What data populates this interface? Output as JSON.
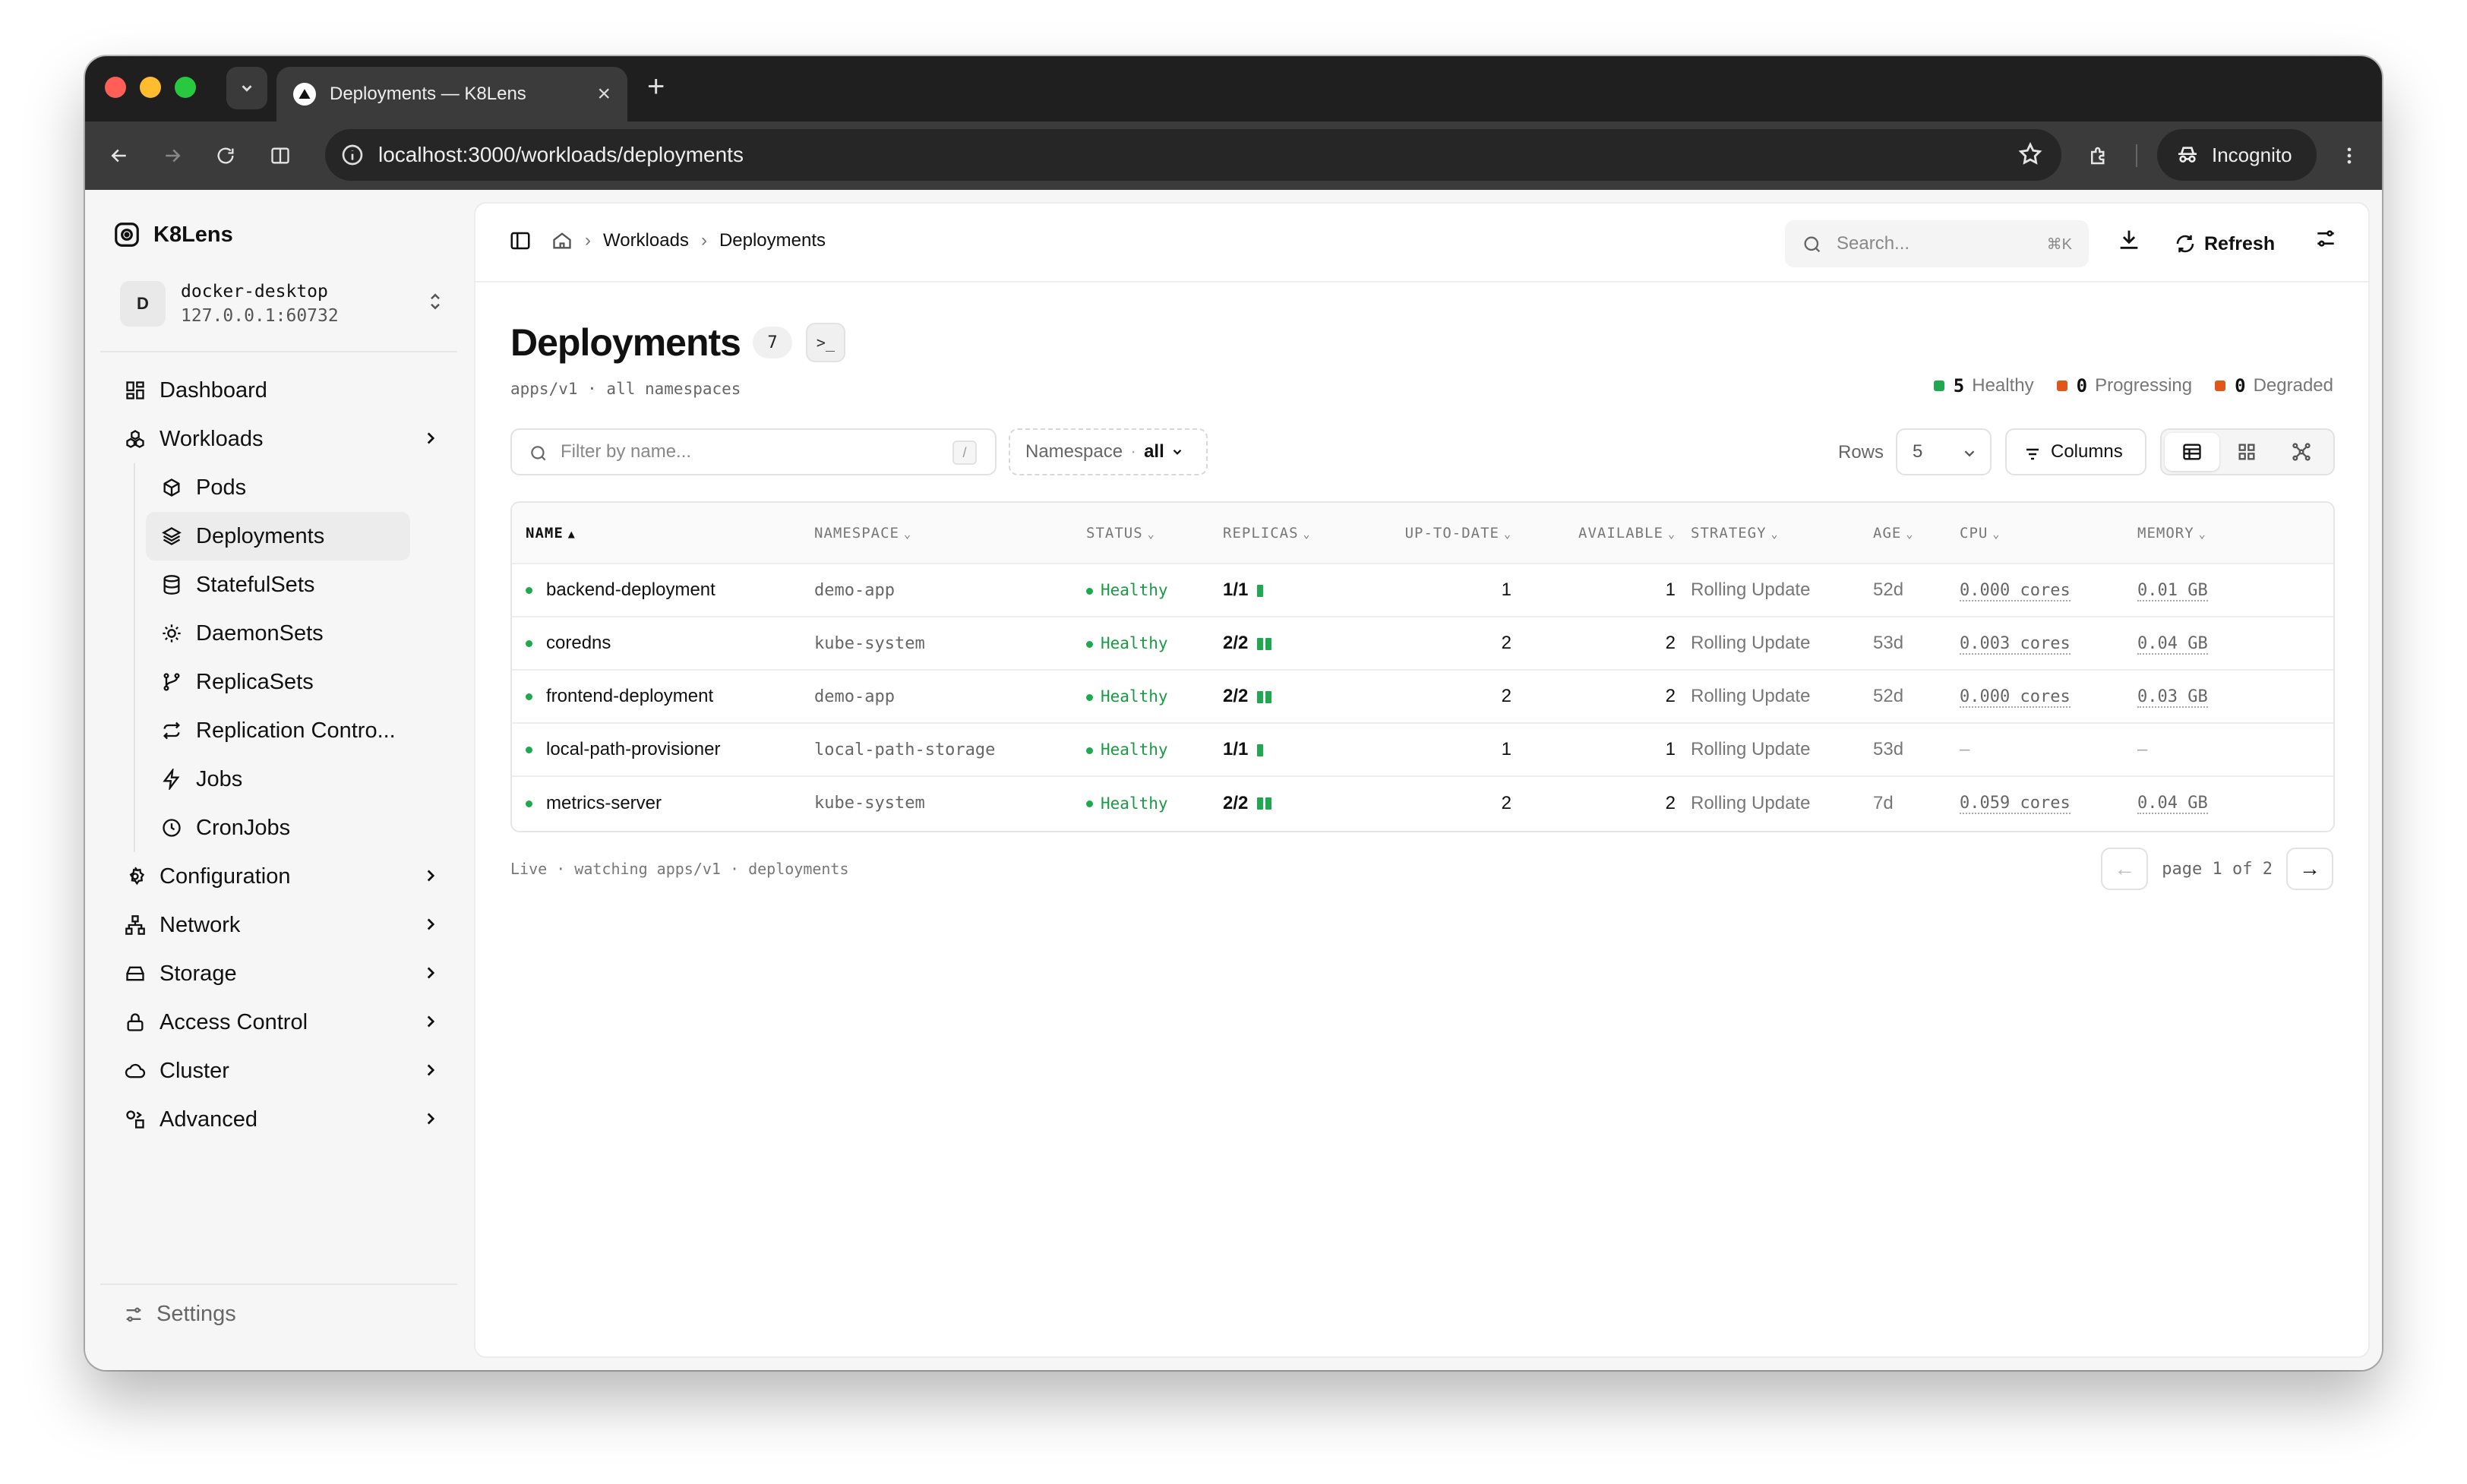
{
  "browser": {
    "tab_title": "Deployments — K8Lens",
    "url": "localhost:3000/workloads/deployments",
    "incognito_label": "Incognito"
  },
  "sidebar": {
    "brand": "K8Lens",
    "context": {
      "avatar": "D",
      "name": "docker-desktop",
      "address": "127.0.0.1:60732"
    },
    "items": [
      {
        "label": "Dashboard",
        "icon": "dashboard-icon"
      },
      {
        "label": "Workloads",
        "icon": "workloads-icon",
        "expanded": true
      },
      {
        "label": "Configuration",
        "icon": "gear-icon"
      },
      {
        "label": "Network",
        "icon": "network-icon"
      },
      {
        "label": "Storage",
        "icon": "storage-icon"
      },
      {
        "label": "Access Control",
        "icon": "lock-icon"
      },
      {
        "label": "Cluster",
        "icon": "cloud-icon"
      },
      {
        "label": "Advanced",
        "icon": "shapes-icon"
      }
    ],
    "workload_items": [
      {
        "label": "Pods",
        "icon": "cube-icon"
      },
      {
        "label": "Deployments",
        "icon": "layers-icon",
        "active": true
      },
      {
        "label": "StatefulSets",
        "icon": "database-icon"
      },
      {
        "label": "DaemonSets",
        "icon": "cog-icon"
      },
      {
        "label": "ReplicaSets",
        "icon": "branch-icon"
      },
      {
        "label": "Replication Contro...",
        "icon": "repeat-icon"
      },
      {
        "label": "Jobs",
        "icon": "bolt-icon"
      },
      {
        "label": "CronJobs",
        "icon": "clock-icon"
      }
    ],
    "settings_label": "Settings"
  },
  "topbar": {
    "breadcrumb": [
      "Workloads",
      "Deployments"
    ],
    "search_placeholder": "Search...",
    "search_shortcut": "⌘K",
    "refresh_label": "Refresh"
  },
  "page": {
    "title": "Deployments",
    "count": "7",
    "term_label": ">_",
    "subtitle": "apps/v1 · all namespaces",
    "summary": {
      "healthy": {
        "count": "5",
        "label": "Healthy",
        "color": "#1fa84f"
      },
      "progressing": {
        "count": "0",
        "label": "Progressing",
        "color": "#e0561b"
      },
      "degraded": {
        "count": "0",
        "label": "Degraded",
        "color": "#e0561b"
      }
    }
  },
  "toolbar": {
    "filter_placeholder": "Filter by name...",
    "filter_shortcut": "/",
    "namespace_label": "Namespace",
    "namespace_value": "all",
    "rows_label": "Rows",
    "rows_value": "5",
    "columns_label": "Columns"
  },
  "table": {
    "headers": [
      "NAME",
      "NAMESPACE",
      "STATUS",
      "REPLICAS",
      "UP-TO-DATE",
      "AVAILABLE",
      "STRATEGY",
      "AGE",
      "CPU",
      "MEMORY"
    ],
    "rows": [
      {
        "name": "backend-deployment",
        "namespace": "demo-app",
        "status": "Healthy",
        "replicas": "1/1",
        "ready": 1,
        "up_to_date": "1",
        "available": "1",
        "strategy": "Rolling Update",
        "age": "52d",
        "cpu": "0.000 cores",
        "memory": "0.01 GB"
      },
      {
        "name": "coredns",
        "namespace": "kube-system",
        "status": "Healthy",
        "replicas": "2/2",
        "ready": 2,
        "up_to_date": "2",
        "available": "2",
        "strategy": "Rolling Update",
        "age": "53d",
        "cpu": "0.003 cores",
        "memory": "0.04 GB"
      },
      {
        "name": "frontend-deployment",
        "namespace": "demo-app",
        "status": "Healthy",
        "replicas": "2/2",
        "ready": 2,
        "up_to_date": "2",
        "available": "2",
        "strategy": "Rolling Update",
        "age": "52d",
        "cpu": "0.000 cores",
        "memory": "0.03 GB"
      },
      {
        "name": "local-path-provisioner",
        "namespace": "local-path-storage",
        "status": "Healthy",
        "replicas": "1/1",
        "ready": 1,
        "up_to_date": "1",
        "available": "1",
        "strategy": "Rolling Update",
        "age": "53d",
        "cpu": "–",
        "memory": "–"
      },
      {
        "name": "metrics-server",
        "namespace": "kube-system",
        "status": "Healthy",
        "replicas": "2/2",
        "ready": 2,
        "up_to_date": "2",
        "available": "2",
        "strategy": "Rolling Update",
        "age": "7d",
        "cpu": "0.059 cores",
        "memory": "0.04 GB"
      }
    ]
  },
  "footer": {
    "live_text": "Live · watching apps/v1 · deployments",
    "page_text": "page 1 of 2",
    "prev": "←",
    "next": "→"
  }
}
